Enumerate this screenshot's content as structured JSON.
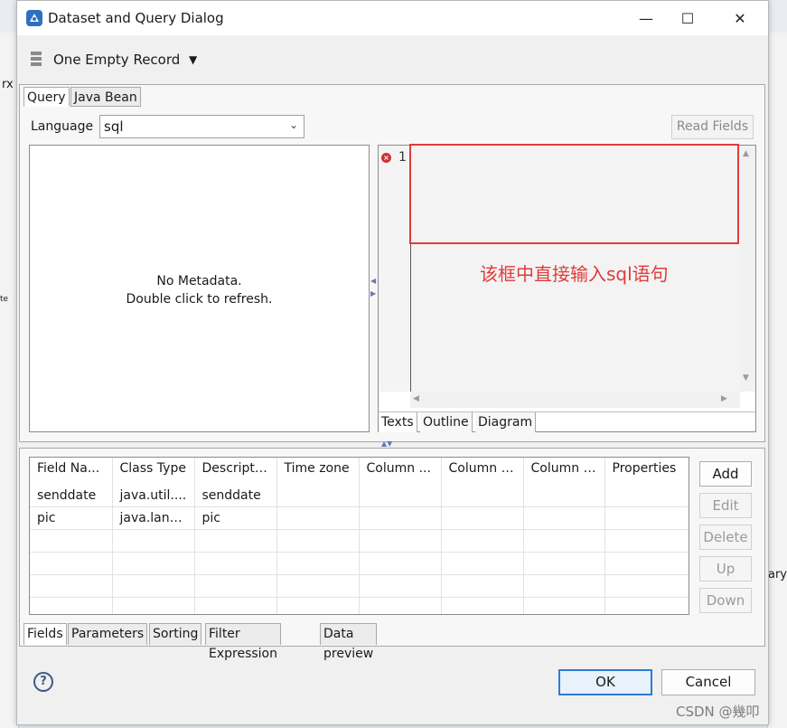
{
  "window": {
    "title": "Dataset and Query Dialog",
    "minimize_icon": "—",
    "maximize_icon": "☐",
    "close_icon": "✕"
  },
  "dataset": {
    "name": "One Empty Record"
  },
  "upper_tabs": [
    "Query",
    "Java Bean"
  ],
  "query": {
    "language_label": "Language",
    "language_value": "sql",
    "read_fields_label": "Read Fields",
    "metadata_line1": "No Metadata.",
    "metadata_line2": "Double click to refresh.",
    "line_number": "1",
    "editor_tabs": [
      "Texts",
      "Outline",
      "Diagram"
    ],
    "annotation": "该框中直接输入sql语句"
  },
  "fields_table": {
    "columns": [
      "Field Na...",
      "Class Type",
      "Descripti...",
      "Time zone",
      "Column ...",
      "Column l...",
      "Column i...",
      "Properties"
    ],
    "rows": [
      [
        "senddate",
        "java.util....",
        "senddate",
        "",
        "",
        "",
        "",
        ""
      ],
      [
        "pic",
        "java.lang....",
        "pic",
        "",
        "",
        "",
        "",
        ""
      ],
      [
        "",
        "",
        "",
        "",
        "",
        "",
        "",
        ""
      ],
      [
        "",
        "",
        "",
        "",
        "",
        "",
        "",
        ""
      ],
      [
        "",
        "",
        "",
        "",
        "",
        "",
        "",
        ""
      ],
      [
        "",
        "",
        "",
        "",
        "",
        "",
        "",
        ""
      ]
    ]
  },
  "side_buttons": {
    "add": "Add",
    "edit": "Edit",
    "delete": "Delete",
    "up": "Up",
    "down": "Down"
  },
  "lower_tabs": [
    "Fields",
    "Parameters",
    "Sorting",
    "Filter Expression",
    "Data preview"
  ],
  "footer": {
    "help_icon": "?",
    "ok_label": "OK",
    "cancel_label": "Cancel"
  },
  "watermark": "CSDN @幾叩",
  "background": {
    "left_fragment": "rx",
    "left_fragment_small": "te",
    "right_fragment": "ary"
  },
  "colors": {
    "annotation_red": "#e03b3b",
    "ok_border": "#2e7bd6"
  }
}
